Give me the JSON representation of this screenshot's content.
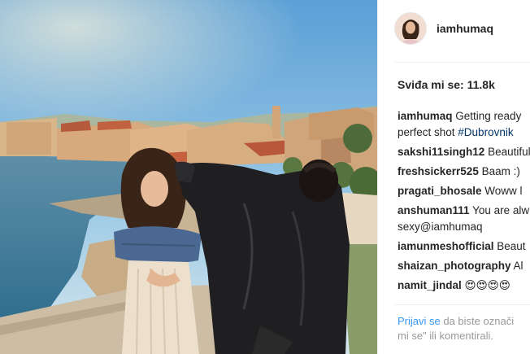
{
  "post": {
    "username": "iamhumaq",
    "likes_text": "Sviđa mi se: 11.8k"
  },
  "comments": [
    {
      "user": "iamhumaq",
      "text": " Getting ready",
      "line2": "perfect shot ",
      "tag": "#Dubrovnik"
    },
    {
      "user": "sakshi11singh12",
      "text": " Beautiful"
    },
    {
      "user": "freshsickerr525",
      "text": " Baam :)"
    },
    {
      "user": "pragati_bhosale",
      "text": " Woww l"
    },
    {
      "user": "anshuman111",
      "text": " You are alw",
      "line2": "sexy@iamhumaq"
    },
    {
      "user": "iamunmeshofficial",
      "text": " Beaut"
    },
    {
      "user": "shaizan_photography",
      "text": " Al"
    },
    {
      "user": "namit_jindal",
      "text": " 😍😍😍😍"
    }
  ],
  "footer": {
    "login_link": "Prijavi se",
    "login_text": " da biste označi",
    "login_line2": "mi se\" ili komentirali."
  },
  "icons": {
    "avatar": "profile-avatar"
  }
}
